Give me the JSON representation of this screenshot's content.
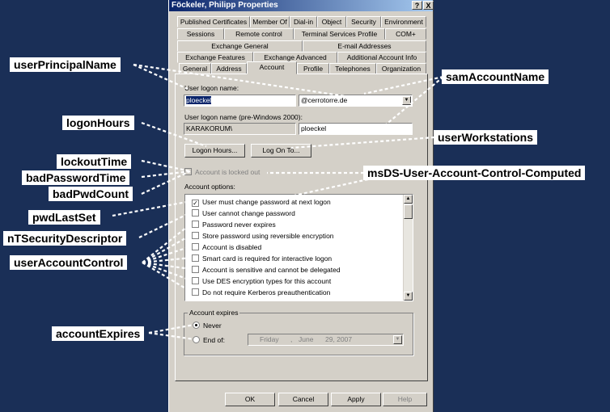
{
  "window": {
    "title": "Föckeler, Philipp Properties",
    "help_btn": "?",
    "close_btn": "X"
  },
  "tabs": {
    "row1": [
      "Published Certificates",
      "Member Of",
      "Dial-in",
      "Object",
      "Security",
      "Environment"
    ],
    "row2": [
      "Sessions",
      "Remote control",
      "Terminal Services Profile",
      "COM+"
    ],
    "row3": [
      "Exchange General",
      "E-mail Addresses"
    ],
    "row4": [
      "Exchange Features",
      "Exchange Advanced",
      "Additional Account Info"
    ],
    "row5": [
      "General",
      "Address",
      "Account",
      "Profile",
      "Telephones",
      "Organization"
    ],
    "active": "Account"
  },
  "account": {
    "logon_name_label": "User logon name:",
    "logon_name_value": "ploeckel",
    "domain_value": "@cerrotorre.de",
    "prewin_label": "User logon name (pre-Windows 2000):",
    "prewin_domain": "KARAKORUM\\",
    "prewin_user": "ploeckel",
    "logon_hours_btn": "Logon Hours...",
    "logon_to_btn": "Log On To...",
    "locked_out_label": "Account is locked out",
    "options_label": "Account options:",
    "options": [
      {
        "label": "User must change password at next logon",
        "checked": true
      },
      {
        "label": "User cannot change password",
        "checked": false
      },
      {
        "label": "Password never expires",
        "checked": false
      },
      {
        "label": "Store password using reversible encryption",
        "checked": false
      },
      {
        "label": "Account is disabled",
        "checked": false
      },
      {
        "label": "Smart card is required for interactive logon",
        "checked": false
      },
      {
        "label": "Account is sensitive and cannot be delegated",
        "checked": false
      },
      {
        "label": "Use DES encryption types for this account",
        "checked": false
      },
      {
        "label": "Do not require Kerberos preauthentication",
        "checked": false
      }
    ],
    "expires_label": "Account expires",
    "never_label": "Never",
    "endof_label": "End of:",
    "date_day": "Friday",
    "date_sep": ",",
    "date_month": "June",
    "date_rest": "29, 2007"
  },
  "footer": {
    "ok": "OK",
    "cancel": "Cancel",
    "apply": "Apply",
    "help": "Help"
  },
  "attributes": {
    "userPrincipalName": "userPrincipalName",
    "samAccountName": "samAccountName",
    "logonHours": "logonHours",
    "userWorkstations": "userWorkstations",
    "lockoutTime": "lockoutTime",
    "badPasswordTime": "badPasswordTime",
    "badPwdCount": "badPwdCount",
    "msDS": "msDS-User-Account-Control-Computed",
    "pwdLastSet": "pwdLastSet",
    "nTSecurityDescriptor": "nTSecurityDescriptor",
    "userAccountControl": "userAccountControl",
    "accountExpires": "accountExpires"
  },
  "colors": {
    "background": "#1a2f57",
    "dialog": "#d4d0c8",
    "titlebar": "#0a246a"
  }
}
